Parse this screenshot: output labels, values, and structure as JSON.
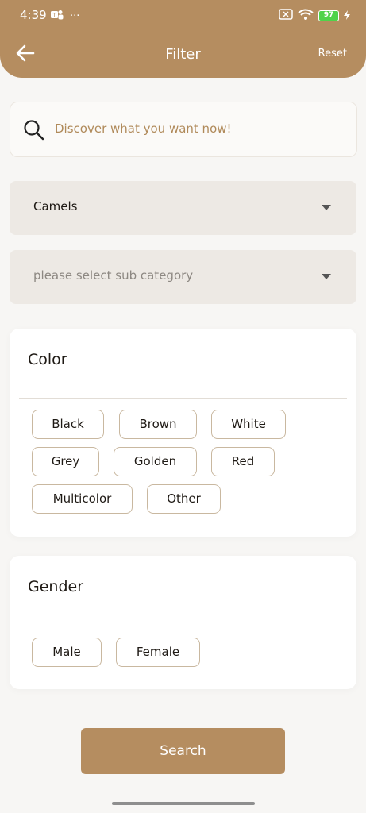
{
  "status_bar": {
    "time": "4:39",
    "more": "···",
    "battery": "97"
  },
  "header": {
    "title": "Filter",
    "reset_label": "Reset"
  },
  "search": {
    "placeholder": "Discover what you want now!"
  },
  "category": {
    "selected": "Camels"
  },
  "sub_category": {
    "placeholder": "please select sub category"
  },
  "color_section": {
    "title": "Color",
    "options": [
      "Black",
      "Brown",
      "White",
      "Grey",
      "Golden",
      "Red",
      "Multicolor",
      "Other"
    ]
  },
  "gender_section": {
    "title": "Gender",
    "options": [
      "Male",
      "Female"
    ]
  },
  "search_button": {
    "label": "Search"
  },
  "colors": {
    "brand": "#b58d60",
    "placeholder_text": "#b08a5a",
    "dropdown_bg": "#ede9e4",
    "chip_border": "#c9b8a0"
  }
}
